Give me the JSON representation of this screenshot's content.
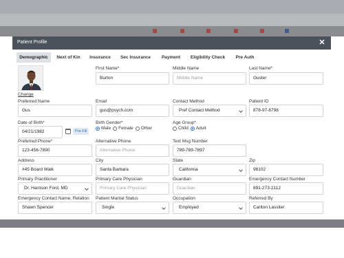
{
  "modal": {
    "title": "Patient Profile",
    "close_icon": "close-icon"
  },
  "tabs": [
    {
      "label": "Demographic",
      "active": true
    },
    {
      "label": "Next of Kin"
    },
    {
      "label": "Insurance"
    },
    {
      "label": "Sec Insurance"
    },
    {
      "label": "Payment"
    },
    {
      "label": "Eligibility Check"
    },
    {
      "label": "Pre Auth"
    }
  ],
  "photo": {
    "change_label": "Change"
  },
  "fields": {
    "first_name": {
      "label": "First Name*",
      "value": "Burton"
    },
    "middle_name": {
      "label": "Middle Name",
      "placeholder": "Middle Name"
    },
    "last_name": {
      "label": "Last Name*",
      "value": "Guster"
    },
    "preferred_name": {
      "label": "Preferred Name",
      "value": "Gus"
    },
    "email": {
      "label": "Email",
      "value": "gus@psych.com"
    },
    "contact_method": {
      "label": "Contact Method",
      "value": "Pref Contact Method"
    },
    "patient_id": {
      "label": "Patient ID",
      "value": "878-97-8798"
    },
    "dob": {
      "label": "Date of Birth*",
      "value": "04/21/1982",
      "prefill": "Pre-Fill"
    },
    "birth_gender": {
      "label": "Birth Gender*",
      "options": [
        "Male",
        "Female",
        "Other"
      ],
      "selected": "Male"
    },
    "age_group": {
      "label": "Age Group*",
      "options": [
        "Child",
        "Adult"
      ],
      "selected": "Adult"
    },
    "preferred_phone": {
      "label": "Preferred Phone*",
      "value": "123-456-7890"
    },
    "alt_phone": {
      "label": "Alternative Phone",
      "placeholder": "Alternative Phone"
    },
    "text_msg": {
      "label": "Text Msg Number",
      "value": "789-789-7897"
    },
    "address": {
      "label": "Address",
      "value": "#45 Board Walk"
    },
    "city": {
      "label": "City",
      "value": "Santa Barbara"
    },
    "state": {
      "label": "State",
      "value": "California"
    },
    "zip": {
      "label": "Zip",
      "value": "98102"
    },
    "primary_practitioner": {
      "label": "Primary Practitioner",
      "value": "Dr. Harrison Ford, MD"
    },
    "primary_care": {
      "label": "Primary Care Physician",
      "placeholder": "Primary Care Physician"
    },
    "guardian": {
      "label": "Guardian",
      "placeholder": "Guardian"
    },
    "emergency_number": {
      "label": "Emergency Contact Number",
      "value": "891-273-2112"
    },
    "emergency_name": {
      "label": "Emergency Contact Name, Relation",
      "value": "Shawn Spencer"
    },
    "marital_status": {
      "label": "Patient Marital Status",
      "value": "Single"
    },
    "occupation": {
      "label": "Occupation",
      "value": "Employed"
    },
    "referred_by": {
      "label": "Referred By",
      "value": "Carlton Lassiter"
    }
  },
  "colors": {
    "header": "#4b5158",
    "tab_active": "#dde0e4",
    "accent": "#2b6cd4"
  }
}
